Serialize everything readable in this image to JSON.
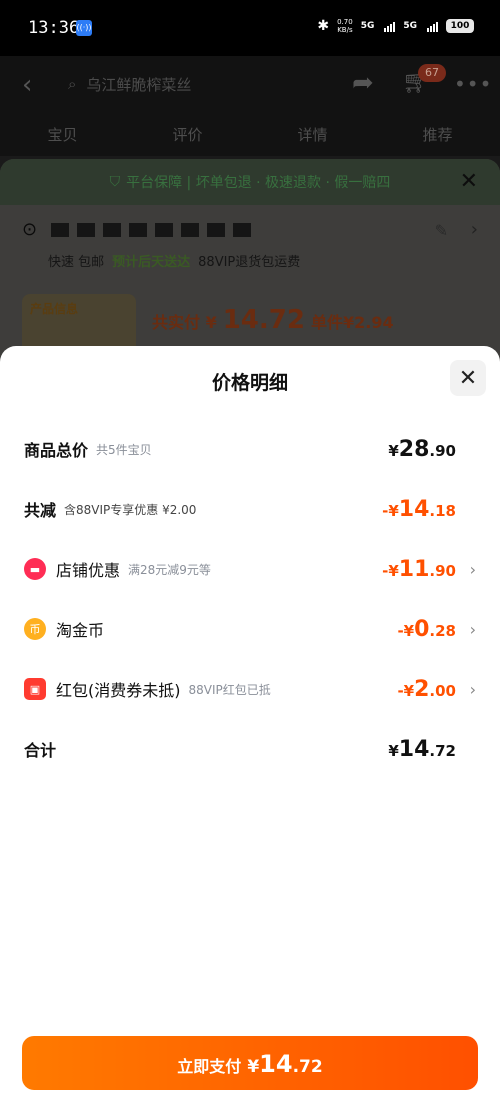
{
  "status_bar": {
    "time": "13:36",
    "nfc_icon": "nfc-icon",
    "net_speed_value": "0.70",
    "net_speed_unit": "KB/s",
    "sim1": "5G",
    "sim2": "5G",
    "battery": "100"
  },
  "background_page": {
    "search_text": "乌江鲜脆榨菜丝",
    "cart_badge": "67",
    "tabs": [
      "宝贝",
      "评价",
      "详情",
      "推荐"
    ],
    "guarantee_text": "平台保障 | 坏单包退 · 极速退款 · 假一赔四",
    "delivery": [
      "快速 包邮",
      "预计后天送达",
      "88VIP退货包运费"
    ],
    "product_tag": "产品信息",
    "price_prefix": "共实付 ¥",
    "price": "14.72",
    "unit_price": "单件¥2.94"
  },
  "price_detail": {
    "title": "价格明细",
    "rows": [
      {
        "label": "商品总价",
        "sub": "共5件宝贝",
        "sym": "¥",
        "int": "28",
        "dec": ".90",
        "color": "#111111"
      },
      {
        "label": "共减",
        "sub": "含88VIP专享优惠 ¥2.00",
        "sym": "-¥",
        "int": "14",
        "dec": ".18",
        "color": "#ff5000"
      },
      {
        "label": "店铺优惠",
        "sub": "满28元减9元等",
        "sym": "-¥",
        "int": "11",
        "dec": ".90",
        "icon": "shop-coupon-icon",
        "icon_color": "#ff2d55"
      },
      {
        "label": "淘金币",
        "sub": "",
        "sym": "-¥",
        "int": "0",
        "dec": ".28",
        "icon": "gold-coin-icon",
        "icon_color": "#ffb020"
      },
      {
        "label": "红包(消费券未抵)",
        "sub": "88VIP红包已抵",
        "sym": "-¥",
        "int": "2",
        "dec": ".00",
        "icon": "red-packet-icon",
        "icon_color": "#ff3b30"
      },
      {
        "label": "合计",
        "sub": "",
        "sym": "¥",
        "int": "14",
        "dec": ".72"
      }
    ]
  },
  "pay_button": {
    "label": "立即支付",
    "sym": "¥",
    "int": "14",
    "dec": ".72"
  }
}
